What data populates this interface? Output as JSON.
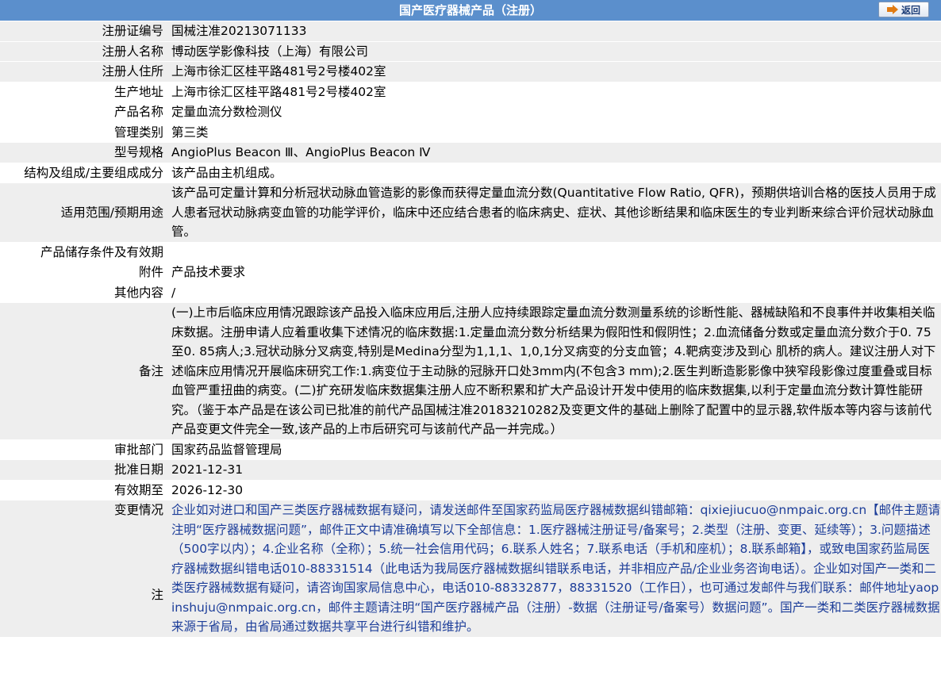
{
  "header": {
    "title": "国产医疗器械产品（注册）",
    "back_label": "返回"
  },
  "rows": {
    "reg_no": {
      "label": "注册证编号",
      "value": "国械注准20213071133"
    },
    "registrant": {
      "label": "注册人名称",
      "value": "博动医学影像科技（上海）有限公司"
    },
    "registrant_address": {
      "label": "注册人住所",
      "value": "上海市徐汇区桂平路481号2号楼402室"
    },
    "production_address": {
      "label": "生产地址",
      "value": "上海市徐汇区桂平路481号2号楼402室"
    },
    "product_name": {
      "label": "产品名称",
      "value": "定量血流分数检测仪"
    },
    "category": {
      "label": "管理类别",
      "value": "第三类"
    },
    "model": {
      "label": "型号规格",
      "value": "AngioPlus Beacon Ⅲ、AngioPlus Beacon Ⅳ"
    },
    "structure": {
      "label": "结构及组成/主要组成成分",
      "value": "该产品由主机组成。"
    },
    "intended_use": {
      "label": "适用范围/预期用途",
      "value": "该产品可定量计算和分析冠状动脉血管造影的影像而获得定量血流分数(Quantitative Flow Ratio, QFR)，预期供培训合格的医技人员用于成人患者冠状动脉病变血管的功能学评价，临床中还应结合患者的临床病史、症状、其他诊断结果和临床医生的专业判断来综合评价冠状动脉血管。"
    },
    "storage": {
      "label": "产品储存条件及有效期",
      "value": ""
    },
    "attachment": {
      "label": "附件",
      "value": "产品技术要求"
    },
    "other": {
      "label": "其他内容",
      "value": "/"
    },
    "remarks": {
      "label": "备注",
      "value": "(一)上市后临床应用情况跟踪该产品投入临床应用后,注册人应持续跟踪定量血流分数测量系统的诊断性能、器械缺陷和不良事件并收集相关临床数据。注册申请人应着重收集下述情况的临床数据:1.定量血流分数分析结果为假阳性和假阴性；2.血流储备分数或定量血流分数介于0. 75至0. 85病人;3.冠状动脉分叉病变,特别是Medina分型为1,1,1、1,0,1分叉病变的分支血管；4.靶病变涉及到心 肌桥的病人。建议注册人对下述临床应用情况开展临床研究工作:1.病变位于主动脉的冠脉开口处3mm内(不包含3 mm);2.医生判断造影影像中狭窄段影像过度重叠或目标血管严重扭曲的病变。(二)扩充研发临床数据集注册人应不断积累和扩大产品设计开发中使用的临床数据集,以利于定量血流分数计算性能研究。（鉴于本产品是在该公司已批准的前代产品国械注准20183210282及变更文件的基础上删除了配置中的显示器,软件版本等内容与该前代产品变更文件完全一致,该产品的上市后研究可与该前代产品一并完成。）"
    },
    "approval_dept": {
      "label": "审批部门",
      "value": "国家药品监督管理局"
    },
    "approval_date": {
      "label": "批准日期",
      "value": "2021-12-31"
    },
    "valid_until": {
      "label": "有效期至",
      "value": "2026-12-30"
    },
    "changes": {
      "label": "变更情况",
      "value": ""
    },
    "note": {
      "label": "注",
      "value": "企业如对进口和国产三类医疗器械数据有疑问，请发送邮件至国家药监局医疗器械数据纠错邮箱：qixiejiucuo@nmpaic.org.cn【邮件主题请注明“医疗器械数据问题”，邮件正文中请准确填写以下全部信息：1.医疗器械注册证号/备案号；2.类型（注册、变更、延续等）；3.问题描述（500字以内）；4.企业名称（全称）；5.统一社会信用代码；6.联系人姓名；7.联系电话（手机和座机）；8.联系邮箱】，或致电国家药监局医疗器械数据纠错电话010-88331514（此电话为我局医疗器械数据纠错联系电话，并非相应产品/企业业务咨询电话）。企业如对国产一类和二类医疗器械数据有疑问，请咨询国家局信息中心，电话010-88332877，88331520（工作日），也可通过发邮件与我们联系：邮件地址yaopinshuju@nmpaic.org.cn，邮件主题请注明“国产医疗器械产品（注册）-数据（注册证号/备案号）数据问题”。国产一类和二类医疗器械数据来源于省局，由省局通过数据共享平台进行纠错和维护。"
    }
  },
  "colors": {
    "header_bg": "#5b8fcc",
    "row_alt_bg": "#eeeeee",
    "note_text": "#1c3d99"
  }
}
